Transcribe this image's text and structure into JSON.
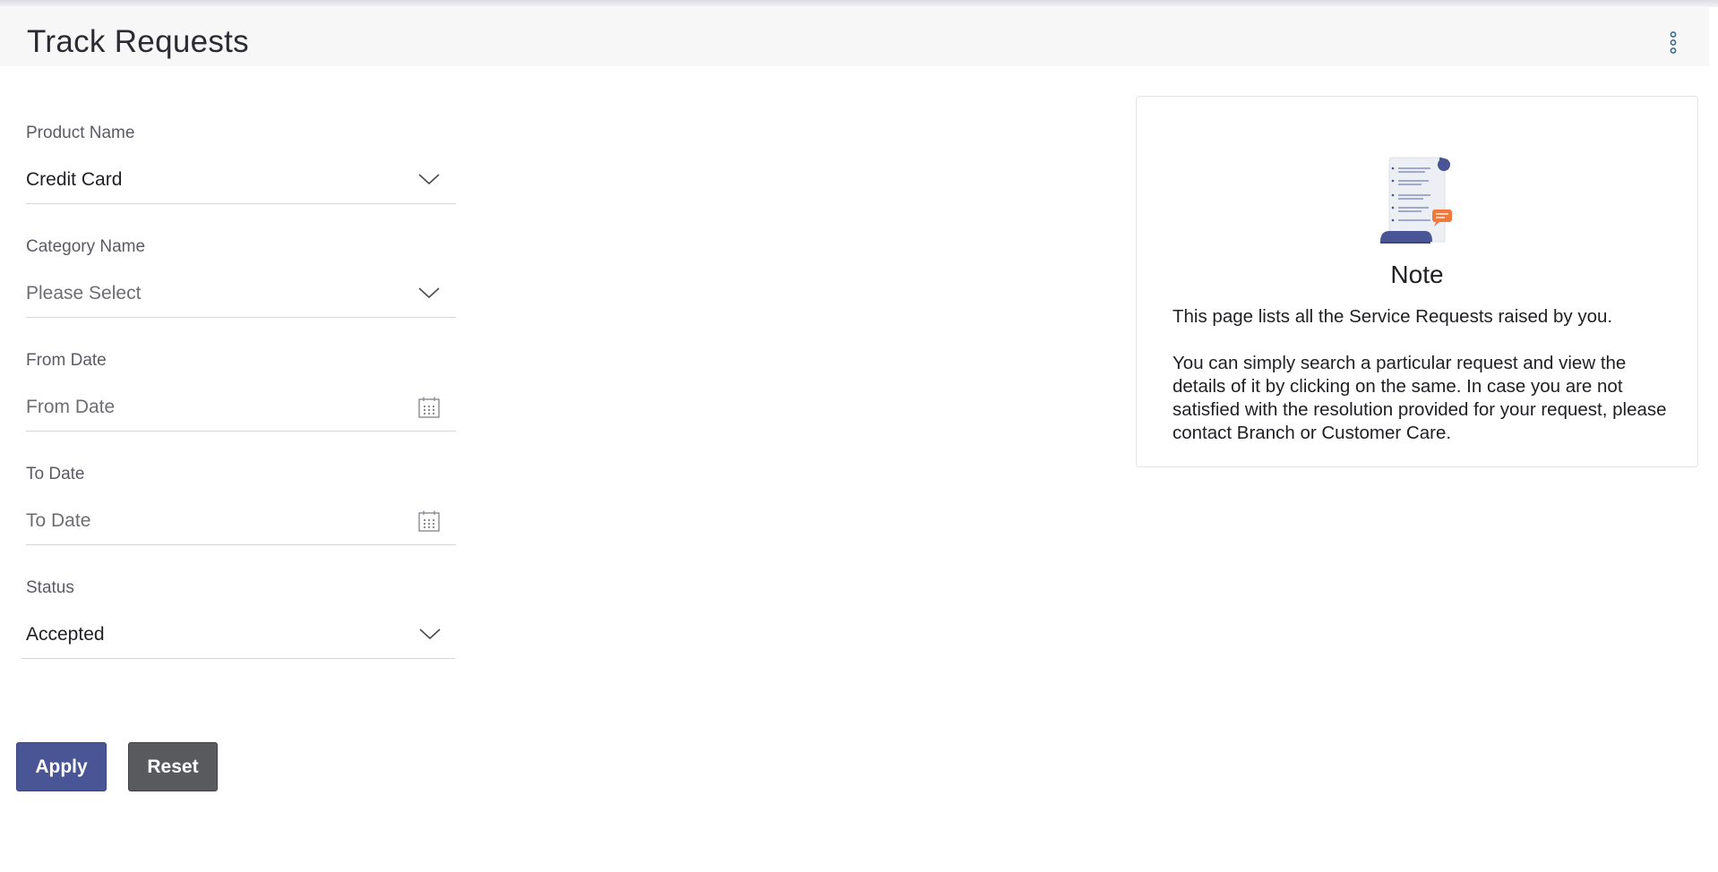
{
  "page": {
    "title": "Track Requests",
    "more_menu_icon": "kebab-vertical-icon"
  },
  "form": {
    "product_name": {
      "label": "Product Name",
      "value": "Credit Card",
      "icon": "chevron-down-icon"
    },
    "category_name": {
      "label": "Category Name",
      "placeholder": "Please Select",
      "icon": "chevron-down-icon"
    },
    "from_date": {
      "label": "From Date",
      "placeholder": "From Date",
      "icon": "calendar-icon"
    },
    "to_date": {
      "label": "To Date",
      "placeholder": "To Date",
      "icon": "calendar-icon"
    },
    "status": {
      "label": "Status",
      "value": "Accepted",
      "icon": "chevron-down-icon"
    }
  },
  "actions": {
    "apply_label": "Apply",
    "reset_label": "Reset"
  },
  "note": {
    "title": "Note",
    "paragraph1": "This page lists all the Service Requests raised by you.",
    "paragraph2": "You can simply search a particular request and view the details of it by clicking on the same. In case you are not satisfied with the resolution provided for your request, please contact Branch or Customer Care.",
    "illustration": "document-scroll-icon"
  },
  "colors": {
    "primary": "#4a5595",
    "secondary": "#585a5e",
    "accent_orange": "#f07a3c",
    "icon_blue": "#3d6b8c"
  }
}
